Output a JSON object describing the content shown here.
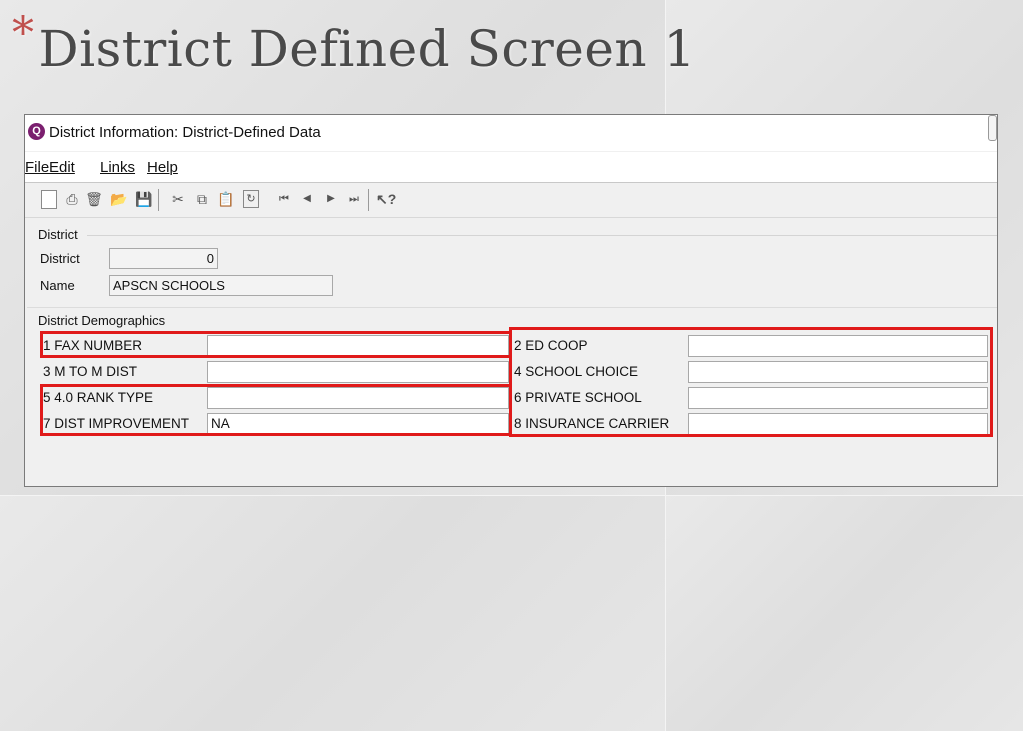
{
  "slide": {
    "title": "District Defined Screen 1",
    "title_mark": "*"
  },
  "window": {
    "title": "District Information: District-Defined Data",
    "icon": "app-logo-icon"
  },
  "menu": [
    "File",
    "Edit",
    "Links",
    "Help"
  ],
  "toolbar_icons": [
    "new-document-icon",
    "print-icon",
    "delete-icon",
    "open-folder-icon",
    "save-icon",
    "cut-icon",
    "copy-icon",
    "paste-icon",
    "refresh-icon",
    "first-record-icon",
    "previous-record-icon",
    "next-record-icon",
    "last-record-icon",
    "help-pointer-icon"
  ],
  "district_section": {
    "label": "District",
    "district_label": "District",
    "district_value": "0",
    "name_label": "Name",
    "name_value": "APSCN SCHOOLS"
  },
  "demographics": {
    "label": "District Demographics",
    "fields": [
      {
        "label": "1 FAX NUMBER",
        "value": ""
      },
      {
        "label": "2 ED COOP",
        "value": ""
      },
      {
        "label": "3 M TO M DIST",
        "value": ""
      },
      {
        "label": "4 SCHOOL CHOICE",
        "value": ""
      },
      {
        "label": "5 4.0 RANK TYPE",
        "value": ""
      },
      {
        "label": "6 PRIVATE SCHOOL",
        "value": ""
      },
      {
        "label": "7 DIST IMPROVEMENT",
        "value": "NA"
      },
      {
        "label": "8 INSURANCE CARRIER",
        "value": ""
      }
    ]
  },
  "highlight_color": "#e01a1a",
  "title_mark_color": "#c0504d"
}
